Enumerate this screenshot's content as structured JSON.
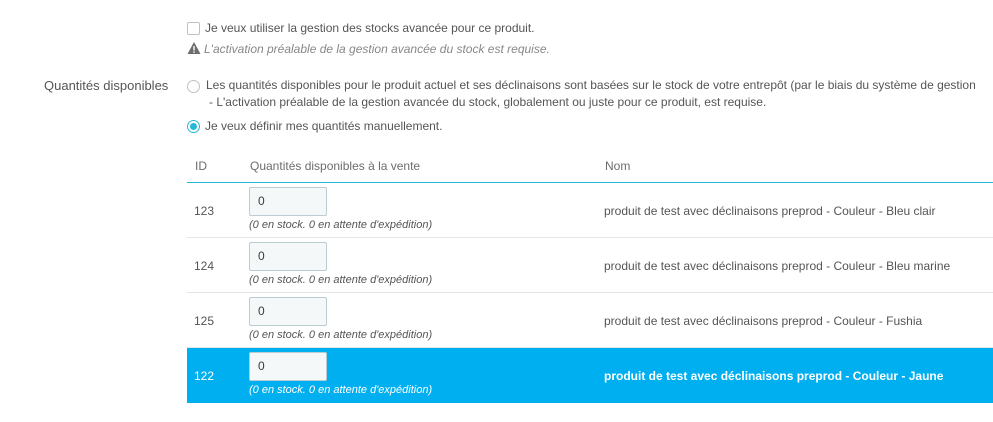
{
  "stock": {
    "advanced_checkbox_label": "Je veux utiliser la gestion des stocks avancée pour ce produit.",
    "advanced_checked": false,
    "warning_text": "L'activation préalable de la gestion avancée du stock est requise."
  },
  "quantities": {
    "label": "Quantités disponibles",
    "option_warehouse_line1": "Les quantités disponibles pour le produit actuel et ses déclinaisons sont basées sur le stock de votre entrepôt (par le biais du système de gestion",
    "option_warehouse_line2": "- L'activation préalable de la gestion avancée du stock, globalement ou juste pour ce produit, est requise.",
    "option_manual": "Je veux définir mes quantités manuellement.",
    "selected_option": "manual"
  },
  "table": {
    "headers": {
      "id": "ID",
      "qty": "Quantités disponibles à la vente",
      "name": "Nom"
    },
    "rows": [
      {
        "id": "123",
        "qty": "0",
        "note": "(0 en stock. 0 en attente d'expédition)",
        "name": "produit de test avec déclinaisons preprod - Couleur - Bleu clair",
        "selected": false
      },
      {
        "id": "124",
        "qty": "0",
        "note": "(0 en stock. 0 en attente d'expédition)",
        "name": "produit de test avec déclinaisons preprod - Couleur - Bleu marine",
        "selected": false
      },
      {
        "id": "125",
        "qty": "0",
        "note": "(0 en stock. 0 en attente d'expédition)",
        "name": "produit de test avec déclinaisons preprod - Couleur - Fushia",
        "selected": false
      },
      {
        "id": "122",
        "qty": "0",
        "note": "(0 en stock. 0 en attente d'expédition)",
        "name": "produit de test avec déclinaisons preprod - Couleur - Jaune",
        "selected": true
      }
    ]
  },
  "colors": {
    "accent": "#25b9d7",
    "selected_row": "#00aff0"
  },
  "icons": {
    "warning": "warning-triangle-icon"
  }
}
